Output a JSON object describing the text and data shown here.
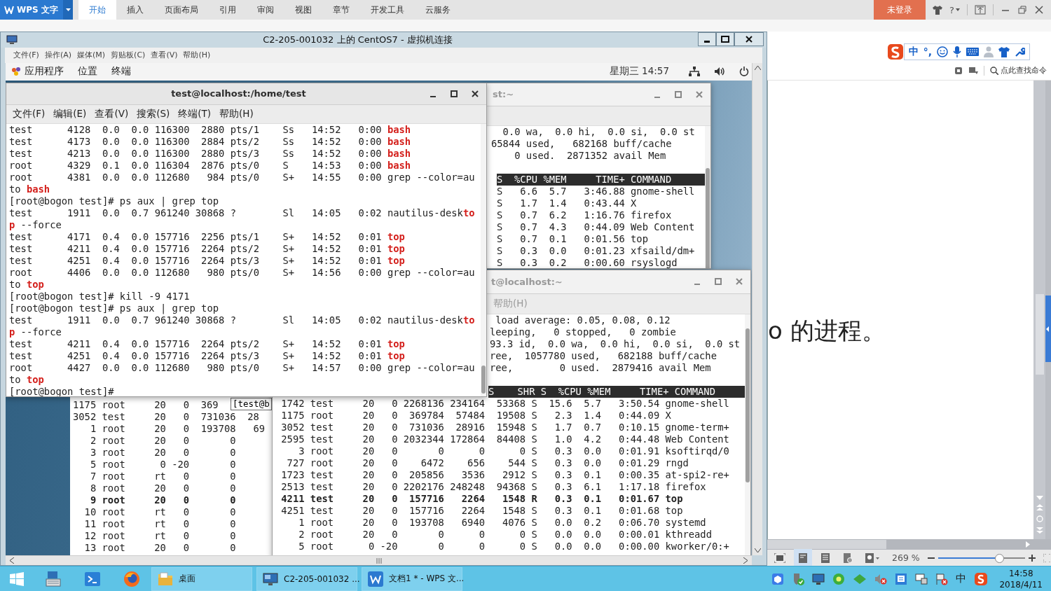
{
  "wps": {
    "app_button": "WPS 文字",
    "tabs": [
      {
        "label": "开始",
        "selected": true
      },
      {
        "label": "插入",
        "selected": false
      },
      {
        "label": "页面布局",
        "selected": false
      },
      {
        "label": "引用",
        "selected": false
      },
      {
        "label": "审阅",
        "selected": false
      },
      {
        "label": "视图",
        "selected": false
      },
      {
        "label": "章节",
        "selected": false
      },
      {
        "label": "开发工具",
        "selected": false
      },
      {
        "label": "云服务",
        "selected": false
      }
    ],
    "login_button": "未登录",
    "help_button": "?"
  },
  "vm": {
    "title": "C2-205-001032 上的 CentOS7 - 虚拟机连接",
    "menu": [
      "文件(F)",
      "操作(A)",
      "媒体(M)",
      "剪贴板(C)",
      "查看(V)",
      "帮助(H)"
    ],
    "gnome_bar": {
      "menu": [
        "应用程序",
        "位置",
        "终端"
      ],
      "clock": "星期三 14:57"
    }
  },
  "terminal_main": {
    "active": true,
    "title": "test@localhost:/home/test",
    "menu": [
      "文件(F)",
      "编辑(E)",
      "查看(V)",
      "搜索(S)",
      "终端(T)",
      "帮助(H)"
    ],
    "lines": [
      "test      4128  0.0  0.0 116300  2880 pts/1    Ss   14:52   0:00 **bash**",
      "test      4173  0.0  0.0 116300  2884 pts/2    Ss   14:52   0:00 **bash**",
      "test      4213  0.0  0.0 116300  2880 pts/3    Ss   14:52   0:00 **bash**",
      "root      4329  0.1  0.0 116304  2876 pts/0    S    14:53   0:00 **bash**",
      "root      4381  0.0  0.0 112680   984 pts/0    S+   14:55   0:00 grep --color=au",
      "to **bash**",
      "[root@bogon test]# ps aux | grep top",
      "test      1911  0.0  0.7 961240 30868 ?        Sl   14:05   0:02 nautilus-desk**to**",
      "**p** --force",
      "test      4171  0.4  0.0 157716  2256 pts/1    S+   14:52   0:01 **top**",
      "test      4211  0.4  0.0 157716  2264 pts/2    S+   14:52   0:01 **top**",
      "test      4251  0.4  0.0 157716  2264 pts/3    S+   14:52   0:01 **top**",
      "root      4406  0.0  0.0 112680   980 pts/0    S+   14:56   0:00 grep --color=au",
      "to **top**",
      "[root@bogon test]# kill -9 4171",
      "[root@bogon test]# ps aux | grep top",
      "test      1911  0.0  0.7 961240 30868 ?        Sl   14:05   0:02 nautilus-desk**to**",
      "**p** --force",
      "test      4211  0.4  0.0 157716  2264 pts/2    S+   14:52   0:01 **top**",
      "test      4251  0.4  0.0 157716  2264 pts/3    S+   14:52   0:01 **top**",
      "root      4427  0.0  0.0 112680   980 pts/0    S+   14:57   0:00 grep --color=au",
      "to **top**",
      "[root@bogon test]#"
    ]
  },
  "terminal_top_right": {
    "active": false,
    "title": "st:~",
    "lines": [
      {
        "kind": "text",
        "text": "  0.0 wa,  0.0 hi,  0.0 si,  0.0 st"
      },
      {
        "kind": "text",
        "text": "65844 used,   682168 buff/cache"
      },
      {
        "kind": "text",
        "text": "    0 used.  2871352 avail Mem"
      },
      {
        "kind": "header",
        "text": "S  %CPU %MEM     TIME+ COMMAND"
      },
      {
        "kind": "row",
        "text": "S   6.6  5.7   3:46.88 gnome-shell"
      },
      {
        "kind": "row",
        "text": "S   1.7  1.4   0:43.44 X"
      },
      {
        "kind": "row",
        "text": "S   0.7  6.2   1:16.76 firefox"
      },
      {
        "kind": "row",
        "text": "S   0.7  4.3   0:44.09 Web Content"
      },
      {
        "kind": "row",
        "text": "S   0.7  0.1   0:01.56 top"
      },
      {
        "kind": "row",
        "text": "S   0.3  0.0   0:01.23 xfsaild/dm+"
      },
      {
        "kind": "row",
        "text": "S   0.3  0.2   0:00.60 rsyslogd"
      }
    ]
  },
  "terminal_bottom_right": {
    "active": false,
    "title": "t@localhost:~",
    "menu": [
      "帮助(H)"
    ],
    "lines": [
      {
        "kind": "text",
        "text": " load average: 0.05, 0.08, 0.12"
      },
      {
        "kind": "text",
        "text": "leeping,   0 stopped,   0 zombie"
      },
      {
        "kind": "text",
        "text": "93.3 id,  0.0 wa,  0.0 hi,  0.0 si,  0.0 st"
      },
      {
        "kind": "text",
        "text": "ree,  1057780 used,   682188 buff/cache"
      },
      {
        "kind": "text",
        "text": "ree,        0 used.  2879416 avail Mem"
      },
      {
        "kind": "header",
        "text": "S    SHR S  %CPU %MEM     TIME+ COMMAND"
      }
    ],
    "rows": [
      {
        "text": " 1742 test     20   0 2268136 234164  53368 S  15.6  5.7   3:50.54 gnome-shell",
        "bold": false
      },
      {
        "text": " 1175 root     20   0  369784  57484  19508 S   2.3  1.4   0:44.09 X",
        "bold": false
      },
      {
        "text": " 3052 test     20   0  731036  28916  15948 S   1.7  0.7   0:10.15 gnome-term+",
        "bold": false
      },
      {
        "text": " 2595 test     20   0 2032344 172864  84408 S   1.0  4.2   0:44.48 Web Content",
        "bold": false
      },
      {
        "text": "    3 root     20   0       0      0      0 S   0.3  0.0   0:01.91 ksoftirqd/0",
        "bold": false
      },
      {
        "text": "  727 root     20   0    6472    656    544 S   0.3  0.0   0:01.29 rngd",
        "bold": false
      },
      {
        "text": " 1723 test     20   0  205856   3536   2912 S   0.3  0.1   0:00.35 at-spi2-re+",
        "bold": false
      },
      {
        "text": " 2513 test     20   0 2202176 248248  94368 S   0.3  6.1   1:17.18 firefox",
        "bold": false
      },
      {
        "text": " 4211 test     20   0  157716   2264   1548 R   0.3  0.1   0:01.67 top",
        "bold": true
      },
      {
        "text": " 4251 test     20   0  157716   2264   1548 S   0.3  0.1   0:01.68 top",
        "bold": false
      },
      {
        "text": "    1 root     20   0  193708   6940   4076 S   0.0  0.2   0:06.70 systemd",
        "bold": false
      },
      {
        "text": "    2 root     20   0       0      0      0 S   0.0  0.0   0:00.01 kthreadd",
        "bold": false
      },
      {
        "text": "    5 root      0 -20       0      0      0 S   0.0  0.0   0:00.00 kworker/0:+",
        "bold": false
      }
    ]
  },
  "terminal_back": {
    "prompt_fragment": "[test@b",
    "rows": [
      {
        "text": "1175 root     20   0  369",
        "bold": false
      },
      {
        "text": "3052 test     20   0  731036  28",
        "bold": false
      },
      {
        "text": "   1 root     20   0  193708   69",
        "bold": false
      },
      {
        "text": "   2 root     20   0       0",
        "bold": false
      },
      {
        "text": "   3 root     20   0       0",
        "bold": false
      },
      {
        "text": "   5 root      0 -20       0",
        "bold": false
      },
      {
        "text": "   7 root     rt   0       0",
        "bold": false
      },
      {
        "text": "   8 root     20   0       0",
        "bold": false
      },
      {
        "text": "   9 root     20   0       0",
        "bold": true
      },
      {
        "text": "  10 root     rt   0       0",
        "bold": false
      },
      {
        "text": "  11 root     rt   0       0",
        "bold": false
      },
      {
        "text": "  12 root     rt   0       0",
        "bold": false
      },
      {
        "text": "  13 root     20   0       0",
        "bold": false
      }
    ]
  },
  "wps_side": {
    "ime_toolbar": [
      "中",
      "°,"
    ],
    "command_search": "点此查找命令",
    "document_text": "o 的进程。",
    "zoom_label": "269 %",
    "zoom_slider": {
      "level": 0.7
    }
  },
  "taskbar": {
    "buttons": [
      {
        "kind": "folder",
        "label": "桌面"
      },
      {
        "kind": "vm",
        "label": "C2-205-001032 ..."
      },
      {
        "kind": "wps",
        "label": "文档1 * - WPS 文..."
      }
    ],
    "tray_ime": "中",
    "clock": {
      "time": "14:58",
      "date": "2018/4/11"
    }
  }
}
